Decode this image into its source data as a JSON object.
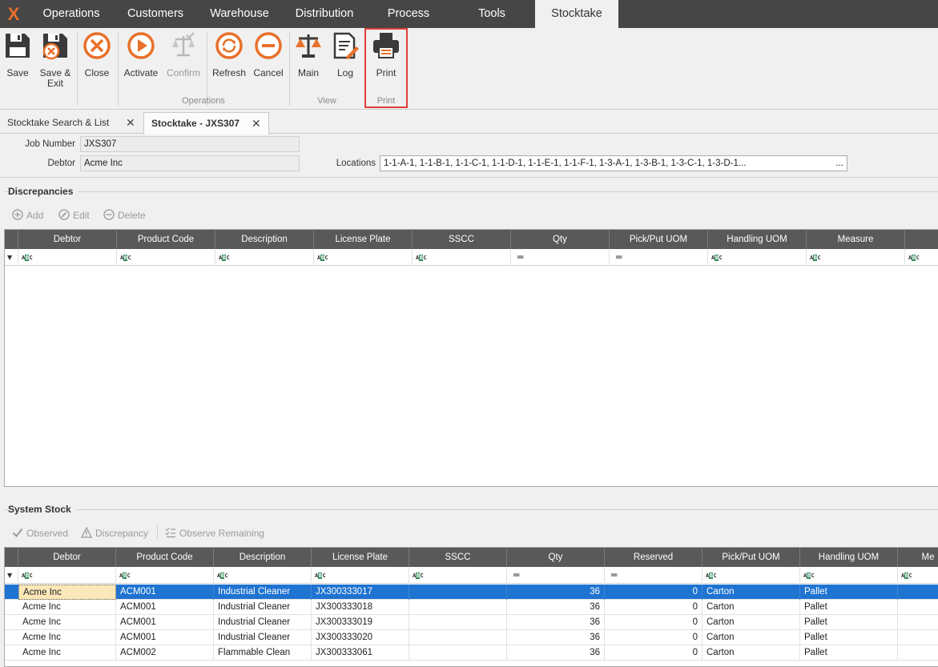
{
  "app": {
    "logo": "X"
  },
  "menu": {
    "tabs": [
      {
        "label": "Operations"
      },
      {
        "label": "Customers"
      },
      {
        "label": "Warehouse"
      },
      {
        "label": "Distribution"
      },
      {
        "label": "Process"
      },
      {
        "label": "Tools"
      },
      {
        "label": "Stocktake"
      }
    ],
    "active_tab": "Stocktake"
  },
  "ribbon": {
    "buttons": {
      "save": {
        "label": "Save",
        "icon": "save-icon"
      },
      "save_exit": {
        "label": "Save &\nExit",
        "label_line1": "Save &",
        "label_line2": "Exit",
        "icon": "save-exit-icon"
      },
      "close": {
        "label": "Close",
        "icon": "close-circle-icon"
      },
      "activate": {
        "label": "Activate",
        "icon": "play-icon"
      },
      "confirm": {
        "label": "Confirm",
        "icon": "scales-check-icon",
        "disabled": true
      },
      "refresh": {
        "label": "Refresh",
        "icon": "refresh-icon"
      },
      "cancel": {
        "label": "Cancel",
        "icon": "minus-circle-icon"
      },
      "main": {
        "label": "Main",
        "icon": "scales-icon"
      },
      "log": {
        "label": "Log",
        "icon": "log-edit-icon"
      },
      "print": {
        "label": "Print",
        "icon": "printer-icon"
      }
    },
    "groups": {
      "operations": "Operations",
      "view": "View",
      "print": "Print"
    }
  },
  "doc_tabs": [
    {
      "label": "Stocktake Search & List",
      "active": false
    },
    {
      "label": "Stocktake - JXS307",
      "active": true
    }
  ],
  "header": {
    "job_number_label": "Job Number",
    "job_number": "JXS307",
    "debtor_label": "Debtor",
    "debtor": "Acme Inc",
    "locations_label": "Locations",
    "locations": "1-1-A-1, 1-1-B-1, 1-1-C-1, 1-1-D-1, 1-1-E-1, 1-1-F-1, 1-3-A-1, 1-3-B-1, 1-3-C-1, 1-3-D-1...",
    "locations_button": "..."
  },
  "discrepancies": {
    "title": "Discrepancies",
    "toolbar": {
      "add": "Add",
      "edit": "Edit",
      "delete": "Delete"
    },
    "columns": [
      "Debtor",
      "Product Code",
      "Description",
      "License Plate",
      "SSCC",
      "Qty",
      "Pick/Put UOM",
      "Handling UOM",
      "Measure"
    ],
    "filter_types": [
      "text",
      "text",
      "text",
      "text",
      "text",
      "equals",
      "equals",
      "text",
      "text",
      "text"
    ],
    "rows": []
  },
  "system_stock": {
    "title": "System Stock",
    "toolbar": {
      "observed": "Observed",
      "discrepancy": "Discrepancy",
      "observe_remaining": "Observe Remaining"
    },
    "columns": [
      "Debtor",
      "Product Code",
      "Description",
      "License Plate",
      "SSCC",
      "Qty",
      "Reserved",
      "Pick/Put UOM",
      "Handling UOM",
      "Me"
    ],
    "rows": [
      {
        "debtor": "Acme Inc",
        "product_code": "ACM001",
        "description": "Industrial Cleaner",
        "license_plate": "JX300333017",
        "sscc": "",
        "qty": "36",
        "reserved": "0",
        "pick_put_uom": "Carton",
        "handling_uom": "Pallet",
        "selected": true
      },
      {
        "debtor": "Acme Inc",
        "product_code": "ACM001",
        "description": "Industrial Cleaner",
        "license_plate": "JX300333018",
        "sscc": "",
        "qty": "36",
        "reserved": "0",
        "pick_put_uom": "Carton",
        "handling_uom": "Pallet"
      },
      {
        "debtor": "Acme Inc",
        "product_code": "ACM001",
        "description": "Industrial Cleaner",
        "license_plate": "JX300333019",
        "sscc": "",
        "qty": "36",
        "reserved": "0",
        "pick_put_uom": "Carton",
        "handling_uom": "Pallet"
      },
      {
        "debtor": "Acme Inc",
        "product_code": "ACM001",
        "description": "Industrial Cleaner",
        "license_plate": "JX300333020",
        "sscc": "",
        "qty": "36",
        "reserved": "0",
        "pick_put_uom": "Carton",
        "handling_uom": "Pallet"
      },
      {
        "debtor": "Acme Inc",
        "product_code": "ACM002",
        "description": "Flammable Clean",
        "license_plate": "JX300333061",
        "sscc": "",
        "qty": "36",
        "reserved": "0",
        "pick_put_uom": "Carton",
        "handling_uom": "Pallet"
      }
    ]
  },
  "colors": {
    "menubar": "#464646",
    "accent_orange": "#e8702a",
    "selection_blue": "#1f73d1",
    "grid_header": "#595959",
    "print_highlight": "#e0403a"
  }
}
